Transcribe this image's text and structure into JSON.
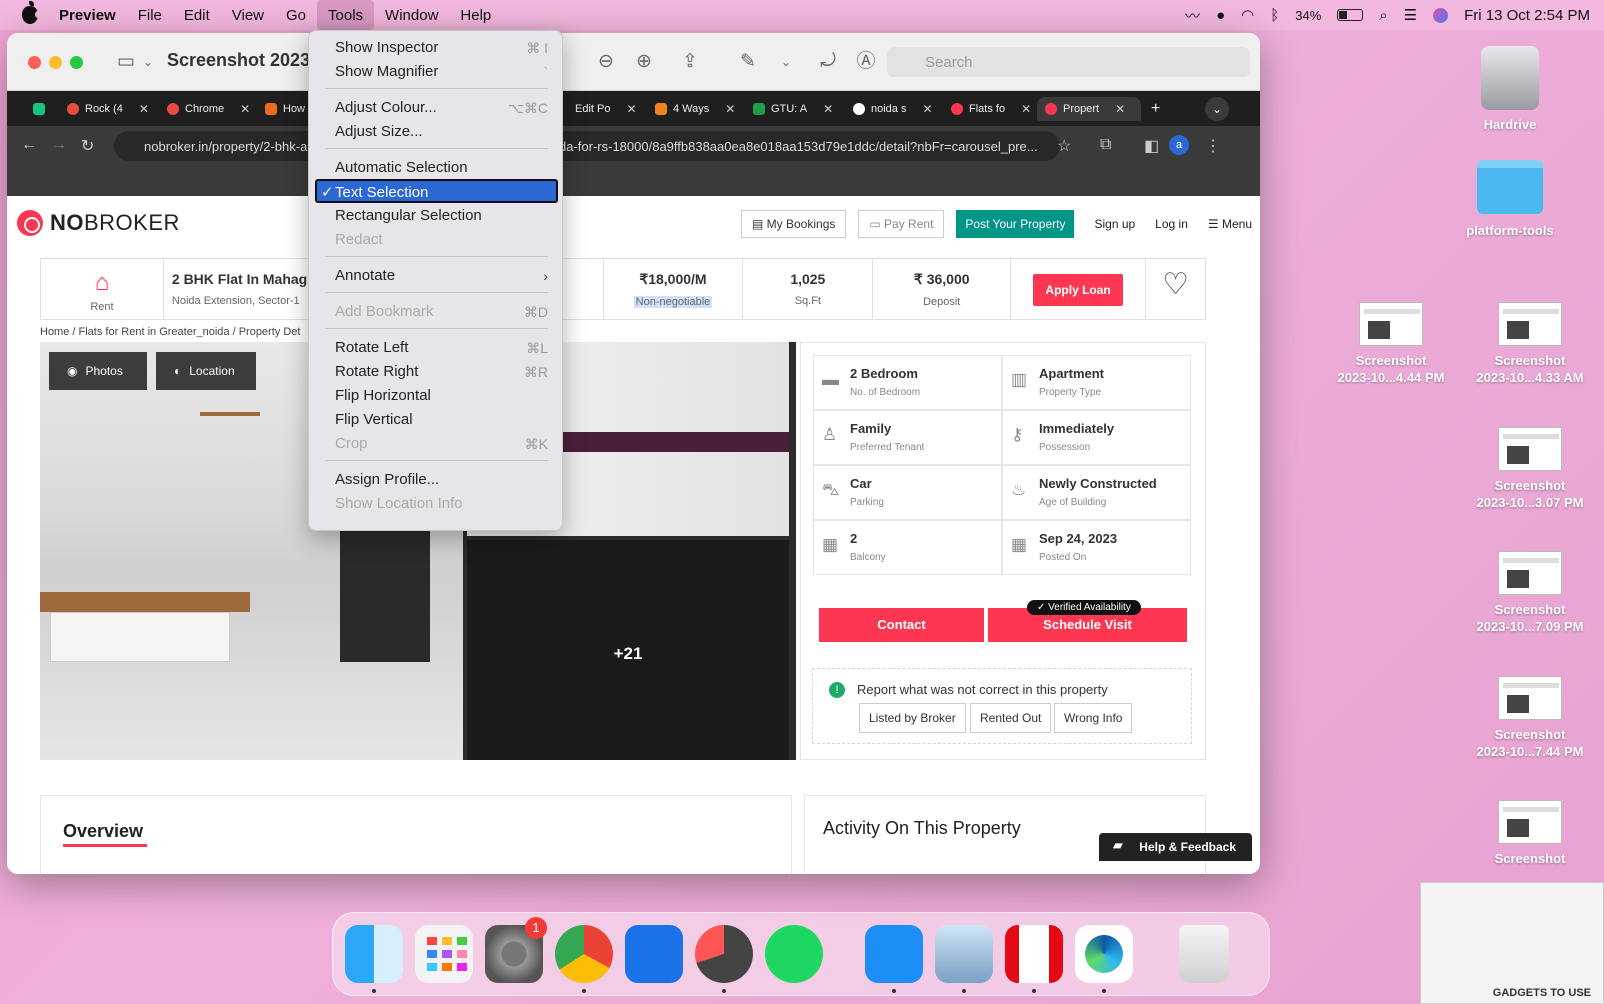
{
  "menubar": {
    "app": "Preview",
    "items": [
      "File",
      "Edit",
      "View",
      "Go",
      "Tools",
      "Window",
      "Help"
    ],
    "battery": "34%",
    "datetime": "Fri 13 Oct  2:54 PM"
  },
  "desktop": {
    "hardrive": "Hardrive",
    "folder": "platform-tools",
    "screenshots": [
      {
        "l1": "Screenshot",
        "l2": "2023-10...4.44 PM"
      },
      {
        "l1": "Screenshot",
        "l2": "2023-10...4.33 AM"
      },
      {
        "l1": "Screenshot",
        "l2": "2023-10...3.07 PM"
      },
      {
        "l1": "Screenshot",
        "l2": "2023-10...7.09 PM"
      },
      {
        "l1": "Screenshot",
        "l2": "2023-10...7.44 PM"
      },
      {
        "l1": "Screenshot",
        "l2": ""
      }
    ],
    "watermark": "GADGETS TO USE"
  },
  "window": {
    "title": "Screenshot 2023-",
    "search_placeholder": "Search"
  },
  "browser": {
    "tabs": [
      "Rock (4",
      "Chrome",
      "How",
      "Edit Po",
      "4 Ways",
      "GTU: A",
      "noida s",
      "Flats fo",
      "Propert"
    ],
    "url_left": "nobroker.in/property/2-bhk-a",
    "url_right": "da-for-rs-18000/8a9ffb838aa0ea8e018aa153d79e1ddc/detail?nbFr=carousel_pre...",
    "profile": "a"
  },
  "page": {
    "logo_bold": "NO",
    "logo_rest": "BROKER",
    "nav": {
      "bookings": "My Bookings",
      "payrent": "Pay Rent",
      "post": "Post Your Property",
      "signup": "Sign up",
      "login": "Log in",
      "menu": "Menu"
    },
    "summary": {
      "rent_label": "Rent",
      "title": "2 BHK Flat In Mahag",
      "subtitle": "Noida Extension, Sector-1",
      "price": "₹18,000/M",
      "price_note": "Non-negotiable",
      "area": "1,025",
      "area_unit": "Sq.Ft",
      "deposit": "₹ 36,000",
      "deposit_label": "Deposit",
      "loan": "Apply Loan"
    },
    "breadcrumb": "Home / Flats for Rent in Greater_noida / Property Det",
    "photos_btn": "Photos",
    "location_btn": "Location",
    "more_photos": "+21",
    "details": [
      {
        "v": "2 Bedroom",
        "k": "No. of Bedroom"
      },
      {
        "v": "Apartment",
        "k": "Property Type"
      },
      {
        "v": "Family",
        "k": "Preferred Tenant"
      },
      {
        "v": "Immediately",
        "k": "Possession"
      },
      {
        "v": "Car",
        "k": "Parking"
      },
      {
        "v": "Newly Constructed",
        "k": "Age of Building"
      },
      {
        "v": "2",
        "k": "Balcony"
      },
      {
        "v": "Sep 24, 2023",
        "k": "Posted On"
      }
    ],
    "contact": "Contact",
    "schedule": "Schedule Visit",
    "verified": "Verified Availability",
    "report_text": "Report what was not correct in this property",
    "report_btns": [
      "Listed by Broker",
      "Rented Out",
      "Wrong Info"
    ],
    "overview": "Overview",
    "activity": "Activity On This Property",
    "help": "Help & Feedback"
  },
  "tools_menu": {
    "show_inspector": "Show Inspector",
    "show_inspector_sc": "⌘ I",
    "show_magnifier": "Show Magnifier",
    "show_magnifier_sc": "`",
    "adjust_colour": "Adjust Colour...",
    "adjust_colour_sc": "⌥⌘C",
    "adjust_size": "Adjust Size...",
    "automatic_selection": "Automatic Selection",
    "text_selection": "Text Selection",
    "rectangular_selection": "Rectangular Selection",
    "redact": "Redact",
    "annotate": "Annotate",
    "add_bookmark": "Add Bookmark",
    "add_bookmark_sc": "⌘D",
    "rotate_left": "Rotate Left",
    "rotate_left_sc": "⌘L",
    "rotate_right": "Rotate Right",
    "rotate_right_sc": "⌘R",
    "flip_horizontal": "Flip Horizontal",
    "flip_vertical": "Flip Vertical",
    "crop": "Crop",
    "crop_sc": "⌘K",
    "assign_profile": "Assign Profile...",
    "show_location": "Show Location Info"
  },
  "dock": {
    "settings_badge": "1"
  }
}
